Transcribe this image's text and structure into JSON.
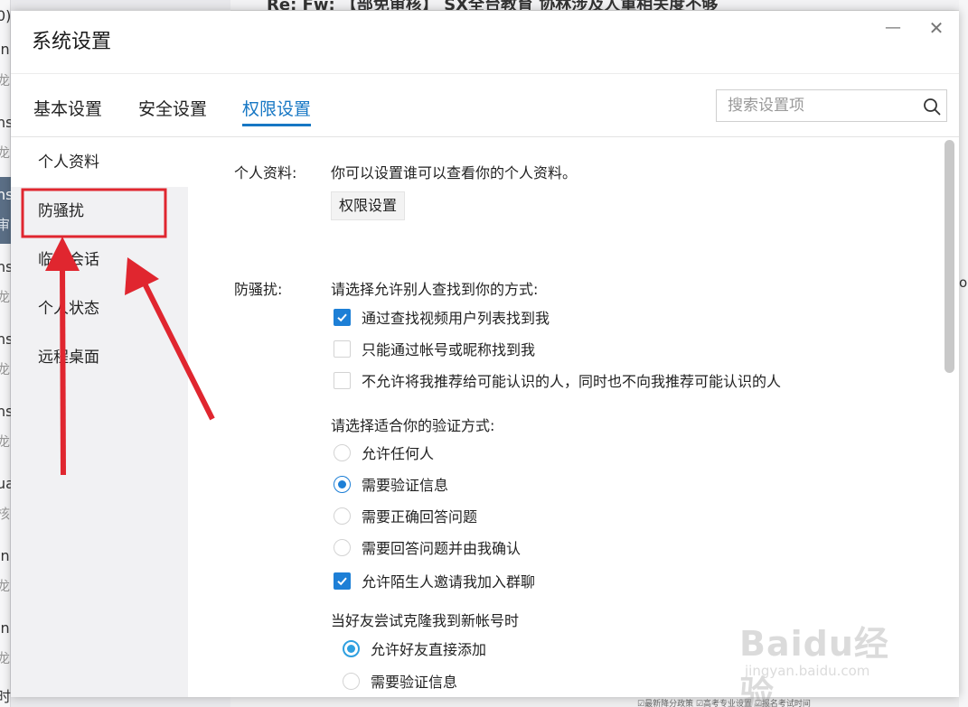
{
  "dialog": {
    "title": "系统设置",
    "minimize_glyph": "—",
    "close_glyph": "✕"
  },
  "tabs": [
    {
      "label": "基本设置",
      "active": false
    },
    {
      "label": "安全设置",
      "active": false
    },
    {
      "label": "权限设置",
      "active": true
    }
  ],
  "search": {
    "placeholder": "搜索设置项",
    "value": "",
    "icon": "search-icon"
  },
  "sidebar": {
    "items": [
      {
        "label": "个人资料",
        "active": true
      },
      {
        "label": "防骚扰",
        "active": false
      },
      {
        "label": "临时会话",
        "active": false
      },
      {
        "label": "个人状态",
        "active": false
      },
      {
        "label": "远程桌面",
        "active": false
      }
    ]
  },
  "profile": {
    "label": "个人资料:",
    "description": "你可以设置谁可以查看你的个人资料。",
    "button": "权限设置"
  },
  "anti_harass": {
    "label": "防骚扰:",
    "find_prompt": "请选择允许别人查找到你的方式:",
    "find_options": [
      {
        "label": "通过查找视频用户列表找到我",
        "checked": true
      },
      {
        "label": "只能通过帐号或昵称找到我",
        "checked": false
      },
      {
        "label": "不允许将我推荐给可能认识的人，同时也不向我推荐可能认识的人",
        "checked": false
      }
    ],
    "verify_prompt": "请选择适合你的验证方式:",
    "verify_options": [
      {
        "label": "允许任何人",
        "selected": false
      },
      {
        "label": "需要验证信息",
        "selected": true
      },
      {
        "label": "需要正确回答问题",
        "selected": false
      },
      {
        "label": "需要回答问题并由我确认",
        "selected": false
      }
    ],
    "group_invite": {
      "label": "允许陌生人邀请我加入群聊",
      "checked": true
    },
    "clone_prompt": "当好友尝试克隆我到新帐号时",
    "clone_options": [
      {
        "label": "允许好友直接添加",
        "selected": true
      },
      {
        "label": "需要验证信息",
        "selected": false
      }
    ]
  },
  "background_window": {
    "title_fragment": "Re: Fw: 【部免审核】 SX全台教育  协林涉及人重相关度不够",
    "left_marks": [
      "0)",
      "in",
      "龙",
      "ns",
      "龙",
      "ns",
      "审",
      "ns",
      "龙",
      "ns",
      "龙",
      "ns",
      "龙",
      "ua",
      "核",
      "in",
      "龙",
      "in",
      "龙",
      "时,"
    ],
    "right_mark": "o.c",
    "bottom_fragment": "☑最新降分政策  ☑高考专业设置  ☑报名考试时间"
  },
  "watermark": {
    "brand": "Baidu经验",
    "url": "jingyan.baidu.com"
  },
  "colors": {
    "accent": "#1677c4",
    "checkbox": "#1d7fd6",
    "annotation": "#e0262f"
  }
}
